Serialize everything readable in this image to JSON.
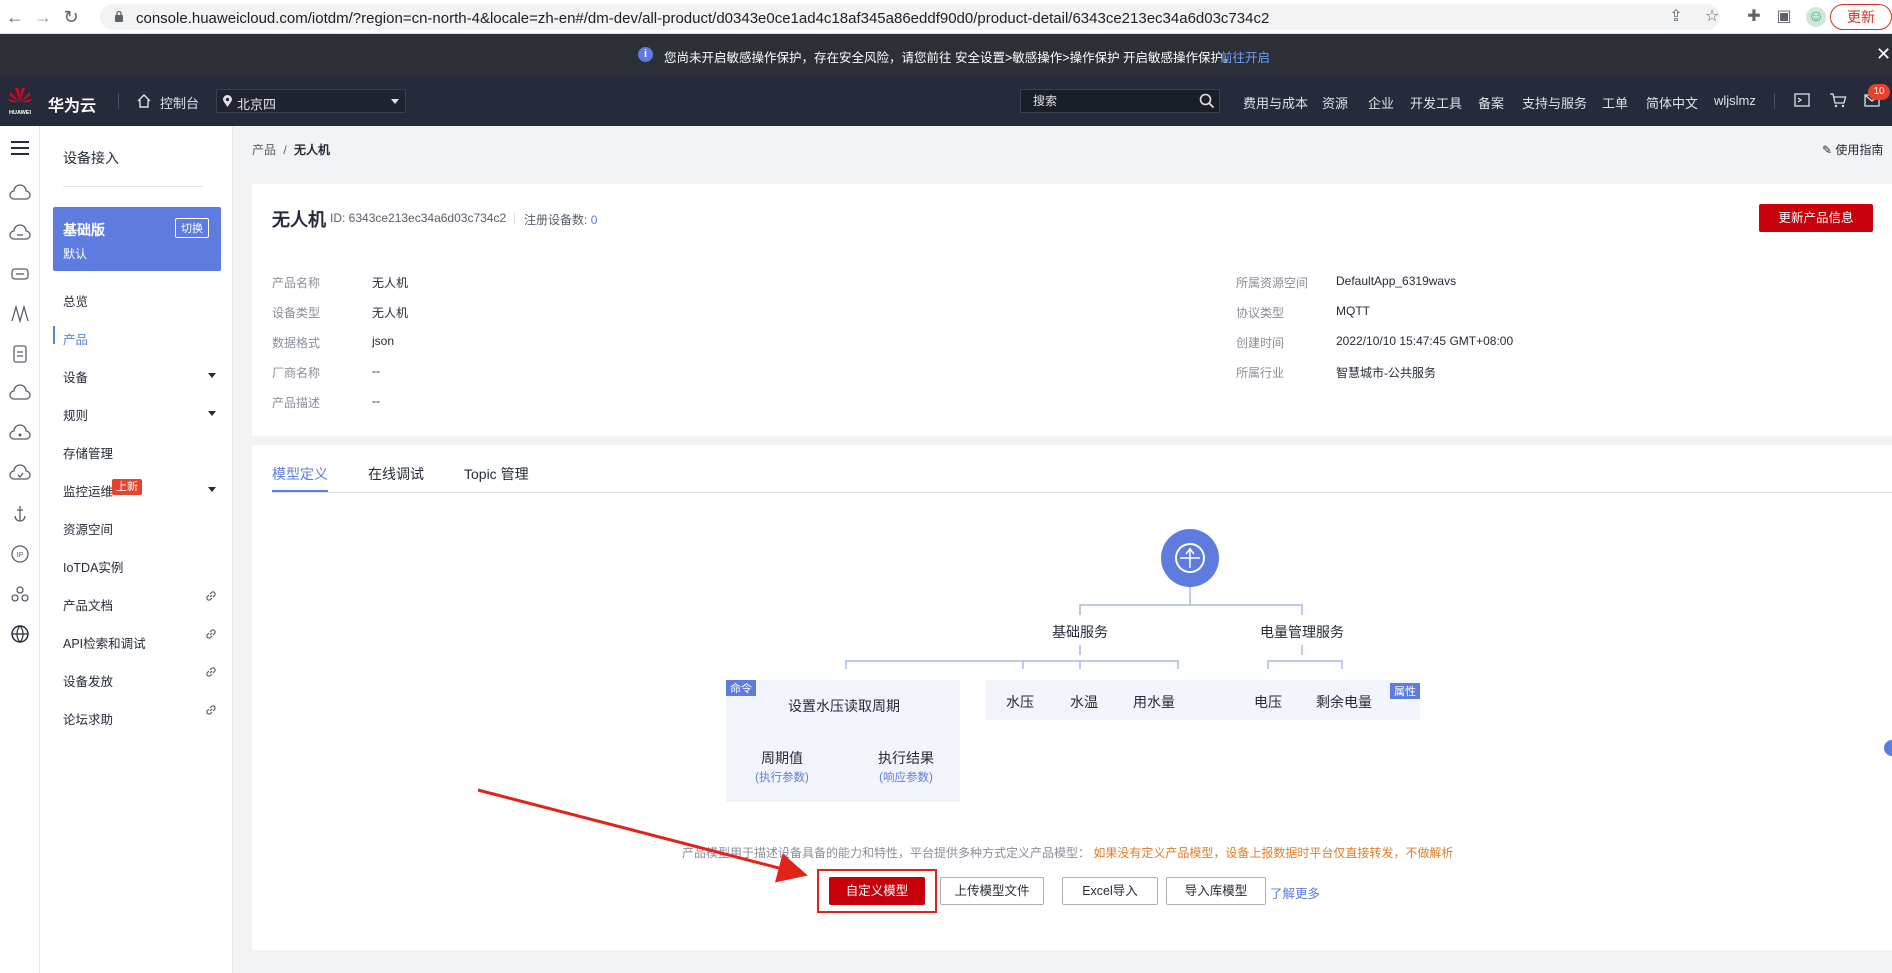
{
  "browser": {
    "url": "console.huaweicloud.com/iotdm/?region=cn-north-4&locale=zh-en#/dm-dev/all-product/d0343e0ce1ad4c18af345a86eddf90d0/product-detail/6343ce213ec34a6d03c734c2",
    "update_label": "更新"
  },
  "notice": {
    "text": "您尚未开启敏感操作保护，存在安全风险，请您前往 安全设置>敏感操作>操作保护 开启敏感操作保护。",
    "link": "前往开启"
  },
  "header": {
    "brand": "华为云",
    "logo_text": "HUAWEI",
    "console": "控制台",
    "region": "北京四",
    "search_placeholder": "搜索",
    "nav": [
      "费用与成本",
      "资源",
      "企业",
      "开发工具",
      "备案",
      "支持与服务",
      "工单",
      "简体中文",
      "wljslmz"
    ],
    "message_count": "10"
  },
  "sidebar": {
    "title": "设备接入",
    "edition": {
      "name": "基础版",
      "switch": "切换",
      "default": "默认"
    },
    "items": [
      {
        "label": "总览"
      },
      {
        "label": "产品"
      },
      {
        "label": "设备"
      },
      {
        "label": "规则"
      },
      {
        "label": "存储管理"
      },
      {
        "label": "监控运维"
      },
      {
        "label": "资源空间"
      },
      {
        "label": "IoTDA实例"
      },
      {
        "label": "产品文档"
      },
      {
        "label": "API检索和调试"
      },
      {
        "label": "设备发放"
      },
      {
        "label": "论坛求助"
      }
    ],
    "new_badge": "上新"
  },
  "breadcrumb": {
    "parent": "产品",
    "sep": "/",
    "current": "无人机"
  },
  "guide": "使用指南",
  "product": {
    "title": "无人机",
    "id_label": "ID: 6343ce213ec34a6d03c734c2",
    "devices_label": "注册设备数:",
    "devices_count": "0",
    "update_button": "更新产品信息",
    "left_fields": [
      {
        "label": "产品名称",
        "value": "无人机"
      },
      {
        "label": "设备类型",
        "value": "无人机"
      },
      {
        "label": "数据格式",
        "value": "json"
      },
      {
        "label": "厂商名称",
        "value": "--"
      },
      {
        "label": "产品描述",
        "value": "--"
      }
    ],
    "right_fields": [
      {
        "label": "所属资源空间",
        "value": "DefaultApp_6319wavs"
      },
      {
        "label": "协议类型",
        "value": "MQTT"
      },
      {
        "label": "创建时间",
        "value": "2022/10/10 15:47:45 GMT+08:00"
      },
      {
        "label": "所属行业",
        "value": "智慧城市-公共服务"
      }
    ]
  },
  "tabs": [
    "模型定义",
    "在线调试",
    "Topic 管理"
  ],
  "diagram": {
    "service_a": "基础服务",
    "service_b": "电量管理服务",
    "command_tag": "命令",
    "property_tag": "属性",
    "command_name": "设置水压读取周期",
    "param_a": "周期值",
    "param_a_sub": "(执行参数)",
    "param_b": "执行结果",
    "param_b_sub": "(响应参数)",
    "props": [
      "水压",
      "水温",
      "用水量",
      "电压",
      "剩余电量"
    ]
  },
  "hint": {
    "gray": "产品模型用于描述设备具备的能力和特性，平台提供多种方式定义产品模型：",
    "orange": "如果没有定义产品模型，设备上报数据时平台仅直接转发，不做解析"
  },
  "actions": {
    "custom": "自定义模型",
    "upload": "上传模型文件",
    "excel": "Excel导入",
    "library": "导入库模型",
    "learn_more": "了解更多"
  }
}
